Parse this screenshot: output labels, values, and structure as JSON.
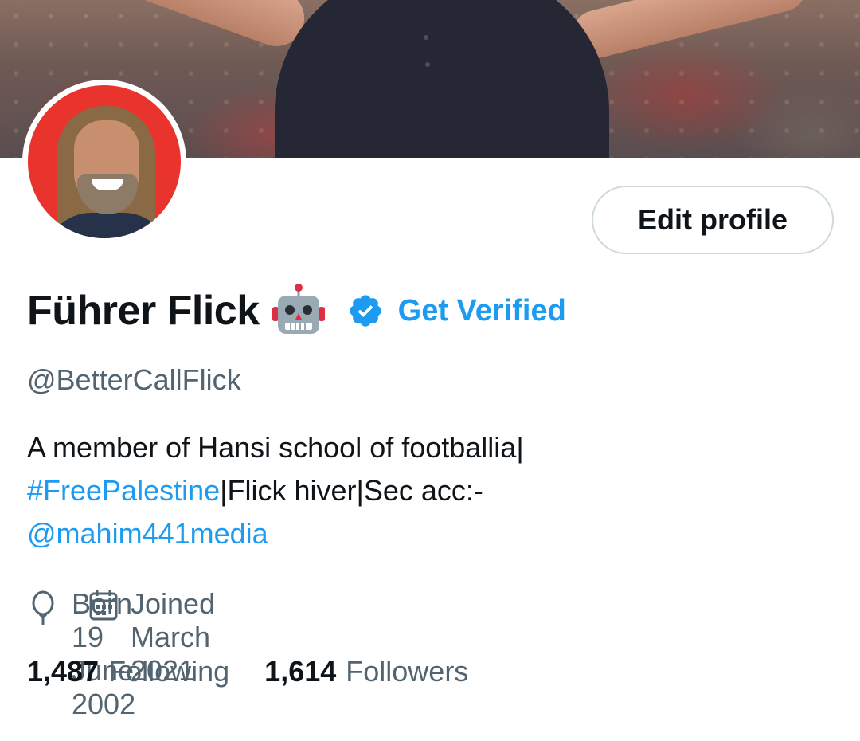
{
  "profile": {
    "display_name": "Führer Flick",
    "name_emoji": "robot-icon",
    "verified_icon": "verified-badge-icon",
    "get_verified_label": "Get Verified",
    "handle": "@BetterCallFlick",
    "edit_profile_label": "Edit profile",
    "bio": {
      "line1": "A member of Hansi school of footballia|",
      "hashtag": "#FreePalestine",
      "line2_rest": "|Flick hiver|Sec acc:-",
      "mention": "@mahim441media"
    },
    "born_text": "Born 19 June 2002",
    "joined_text": "Joined March 2021",
    "stats": {
      "following_count": "1,487",
      "following_label": "Following",
      "followers_count": "1,614",
      "followers_label": "Followers"
    }
  },
  "colors": {
    "accent": "#1d9bf0",
    "text_primary": "#0f1419",
    "text_secondary": "#536471",
    "border": "#cfd9de",
    "avatar_bg": "#e8342c"
  }
}
